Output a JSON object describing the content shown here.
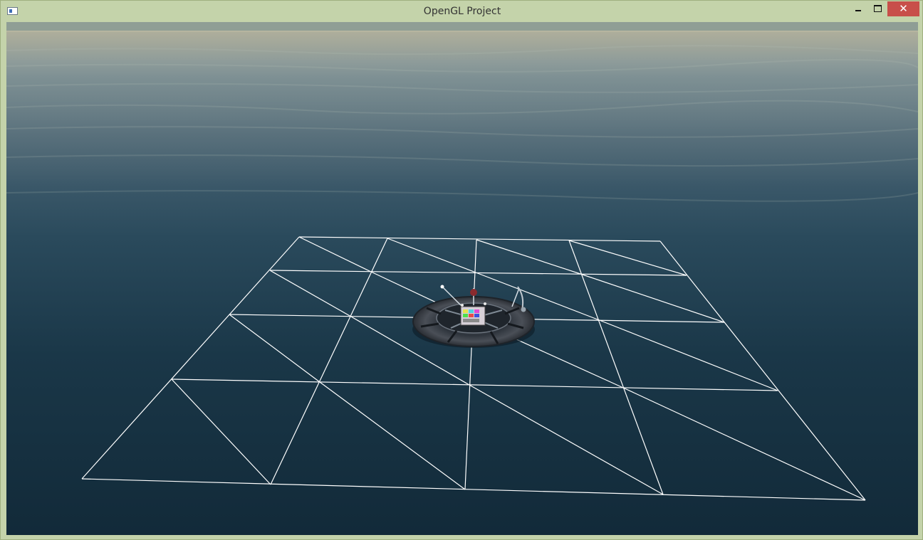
{
  "window": {
    "title": "OpenGL Project",
    "controls": {
      "minimize": "minimize",
      "maximize": "maximize",
      "close": "✕"
    },
    "frame_color": "#c4d3aa",
    "close_color": "#c84f4a"
  },
  "scene": {
    "sky_haze_color": "#8a9a92",
    "water_far_color": "#5c7888",
    "water_near_color": "#132d3c",
    "grid_line_color": "#ffffff",
    "grid": {
      "rows": 4,
      "columns": 4,
      "diagonals": true
    },
    "platform": {
      "ring_color": "#3a3f47",
      "center_panel": "color-test-panel"
    }
  }
}
